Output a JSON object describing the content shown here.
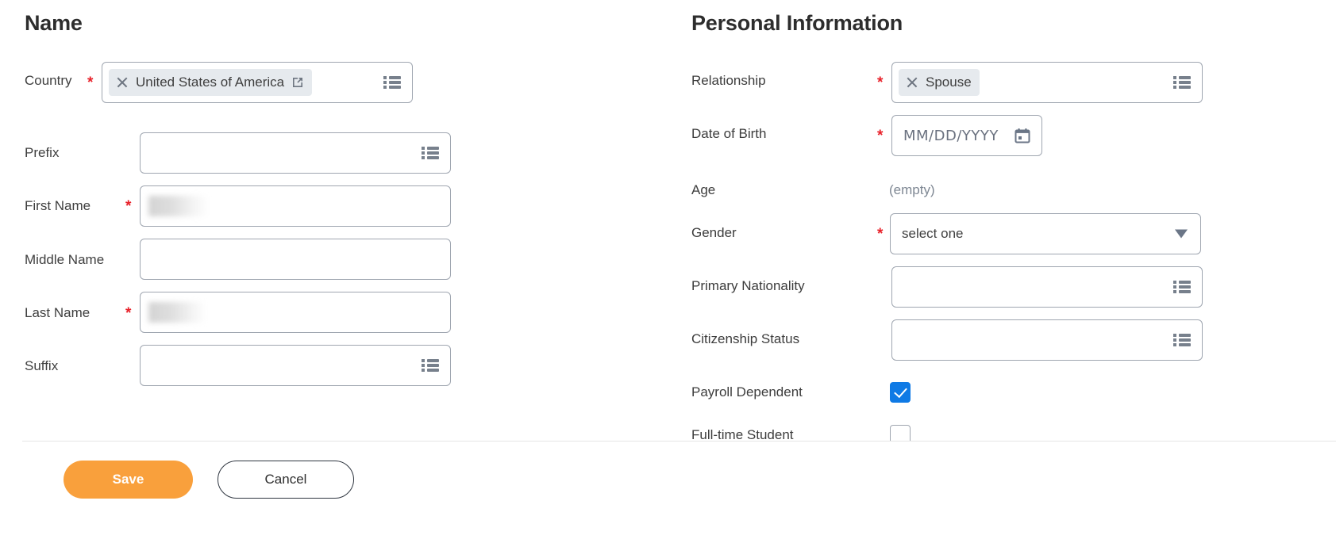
{
  "colors": {
    "required_star": "#e8212a",
    "save_button_bg": "#f9a03c",
    "checkbox_checked_bg": "#0f7ae5",
    "pill_bg": "#e6eaee",
    "input_border": "#9fa6b0",
    "label_text": "#3f3f3f",
    "empty_value_text": "#7e8793"
  },
  "left_column": {
    "title": "Name",
    "fields": {
      "country": {
        "label": "Country",
        "required_marker": "*",
        "value": "United States of America",
        "remove_icon": "close-icon",
        "external_link_icon": "external-link-icon",
        "prompt_icon": "prompt-list-icon"
      },
      "prefix": {
        "label": "Prefix",
        "value": "",
        "prompt_icon": "prompt-list-icon"
      },
      "first_name": {
        "label": "First Name",
        "required_marker": "*",
        "value": ""
      },
      "middle_name": {
        "label": "Middle Name",
        "value": ""
      },
      "last_name": {
        "label": "Last Name",
        "required_marker": "*",
        "value": ""
      },
      "suffix": {
        "label": "Suffix",
        "value": "",
        "prompt_icon": "prompt-list-icon"
      }
    }
  },
  "right_column": {
    "title": "Personal Information",
    "fields": {
      "relationship": {
        "label": "Relationship",
        "required_marker": "*",
        "value": "Spouse",
        "remove_icon": "close-icon",
        "prompt_icon": "prompt-list-icon"
      },
      "date_of_birth": {
        "label": "Date of Birth",
        "required_marker": "*",
        "placeholder": "MM/DD/YYYY",
        "value": "",
        "calendar_icon": "calendar-icon"
      },
      "age": {
        "label": "Age",
        "value": "(empty)"
      },
      "gender": {
        "label": "Gender",
        "required_marker": "*",
        "value": "select one",
        "caret_icon": "chevron-down-icon"
      },
      "primary_nationality": {
        "label": "Primary Nationality",
        "value": "",
        "prompt_icon": "prompt-list-icon"
      },
      "citizenship_status": {
        "label": "Citizenship Status",
        "value": "",
        "prompt_icon": "prompt-list-icon"
      },
      "payroll_dependent": {
        "label": "Payroll Dependent",
        "checked": true
      },
      "full_time_student": {
        "label": "Full-time Student",
        "checked": false
      }
    }
  },
  "footer": {
    "save_label": "Save",
    "cancel_label": "Cancel"
  }
}
